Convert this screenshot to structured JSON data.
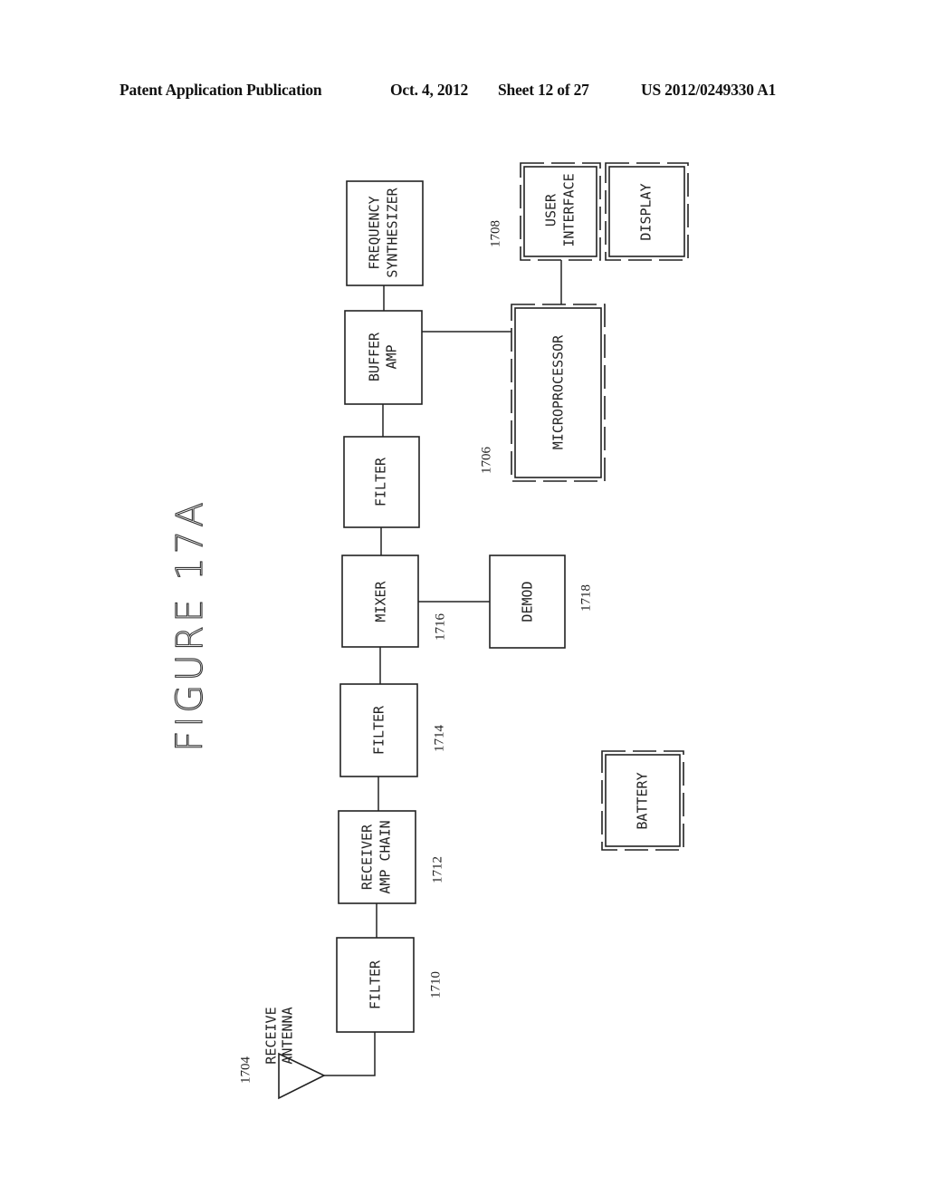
{
  "header": {
    "publication": "Patent Application Publication",
    "date": "Oct. 4, 2012",
    "sheet": "Sheet 12 of 27",
    "patent_number": "US 2012/0249330 A1"
  },
  "figure": {
    "title": "FIGURE 17A",
    "orientation": "rotated 90° counter-clockwise",
    "blocks": [
      {
        "id": "antenna",
        "lines": [
          "RECEIVE",
          "ANTENNA"
        ],
        "ref": "1704"
      },
      {
        "id": "filter-1710",
        "lines": [
          "FILTER"
        ],
        "ref": "1710"
      },
      {
        "id": "receiver-amp-chain",
        "lines": [
          "RECEIVER",
          "AMP CHAIN"
        ],
        "ref": "1712"
      },
      {
        "id": "filter-1714",
        "lines": [
          "FILTER"
        ],
        "ref": "1714"
      },
      {
        "id": "mixer",
        "lines": [
          "MIXER"
        ],
        "ref": "1716"
      },
      {
        "id": "demod",
        "lines": [
          "DEMOD"
        ],
        "ref": "1718"
      },
      {
        "id": "filter-top",
        "lines": [
          "FILTER"
        ],
        "ref": ""
      },
      {
        "id": "buffer-amp",
        "lines": [
          "BUFFER",
          "AMP"
        ],
        "ref": ""
      },
      {
        "id": "frequency-synthesizer",
        "lines": [
          "FREQUENCY",
          "SYNTHESIZER"
        ],
        "ref": ""
      },
      {
        "id": "microprocessor",
        "lines": [
          "MICROPROCESSOR"
        ],
        "ref": "1706"
      },
      {
        "id": "user-interface",
        "lines": [
          "USER",
          "INTERFACE"
        ],
        "ref": "1708"
      },
      {
        "id": "display",
        "lines": [
          "DISPLAY"
        ],
        "ref": ""
      },
      {
        "id": "battery",
        "lines": [
          "BATTERY"
        ],
        "ref": ""
      }
    ],
    "connections": [
      [
        "antenna",
        "filter-1710"
      ],
      [
        "filter-1710",
        "receiver-amp-chain"
      ],
      [
        "receiver-amp-chain",
        "filter-1714"
      ],
      [
        "filter-1714",
        "mixer"
      ],
      [
        "mixer",
        "demod"
      ],
      [
        "mixer",
        "filter-top"
      ],
      [
        "filter-top",
        "buffer-amp"
      ],
      [
        "buffer-amp",
        "frequency-synthesizer"
      ],
      [
        "buffer-amp",
        "microprocessor"
      ],
      [
        "microprocessor",
        "user-interface"
      ]
    ]
  }
}
